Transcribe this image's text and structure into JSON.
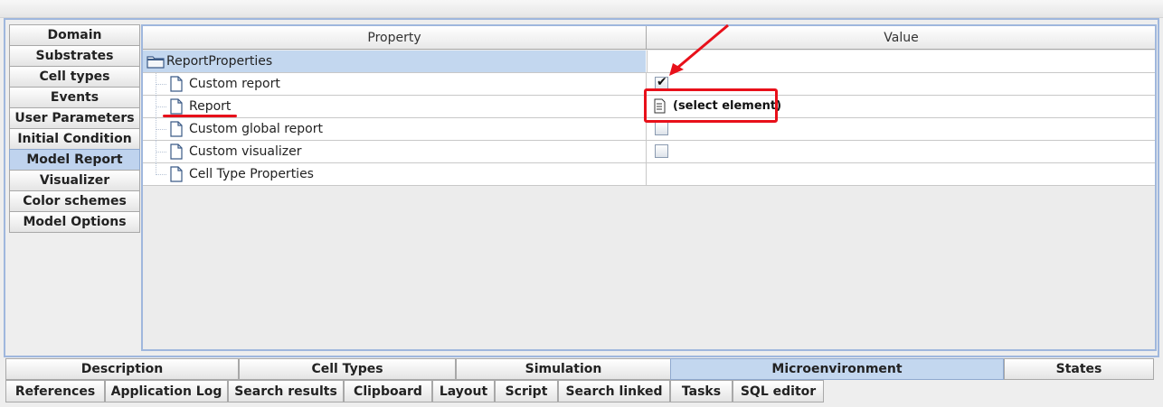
{
  "left_tabs": [
    "Domain",
    "Substrates",
    "Cell types",
    "Events",
    "User Parameters",
    "Initial Condition",
    "Model Report",
    "Visualizer",
    "Color schemes",
    "Model Options"
  ],
  "active_left_tab": "Model Report",
  "table": {
    "headers": {
      "property": "Property",
      "value": "Value"
    },
    "group": "ReportProperties",
    "rows": [
      {
        "label": "Custom report",
        "type": "checkbox",
        "checked": true
      },
      {
        "label": "Report",
        "type": "element",
        "value": "(select element)"
      },
      {
        "label": "Custom global report",
        "type": "checkbox",
        "checked": false
      },
      {
        "label": "Custom visualizer",
        "type": "checkbox",
        "checked": false
      },
      {
        "label": "Cell Type Properties",
        "type": "empty"
      }
    ]
  },
  "check_mark": "✔",
  "bottom_tabs_row1": [
    "Description",
    "Cell Types",
    "Simulation",
    "Microenvironment",
    "States"
  ],
  "active_bottom_tab": "Microenvironment",
  "bottom_tabs_row2": [
    "References",
    "Application Log",
    "Search results",
    "Clipboard",
    "Layout",
    "Script",
    "Search linked",
    "Tasks",
    "SQL editor"
  ],
  "colors": {
    "accent": "#c3d7ef",
    "annotation": "#e8101a",
    "frame": "#9fb7dd"
  }
}
